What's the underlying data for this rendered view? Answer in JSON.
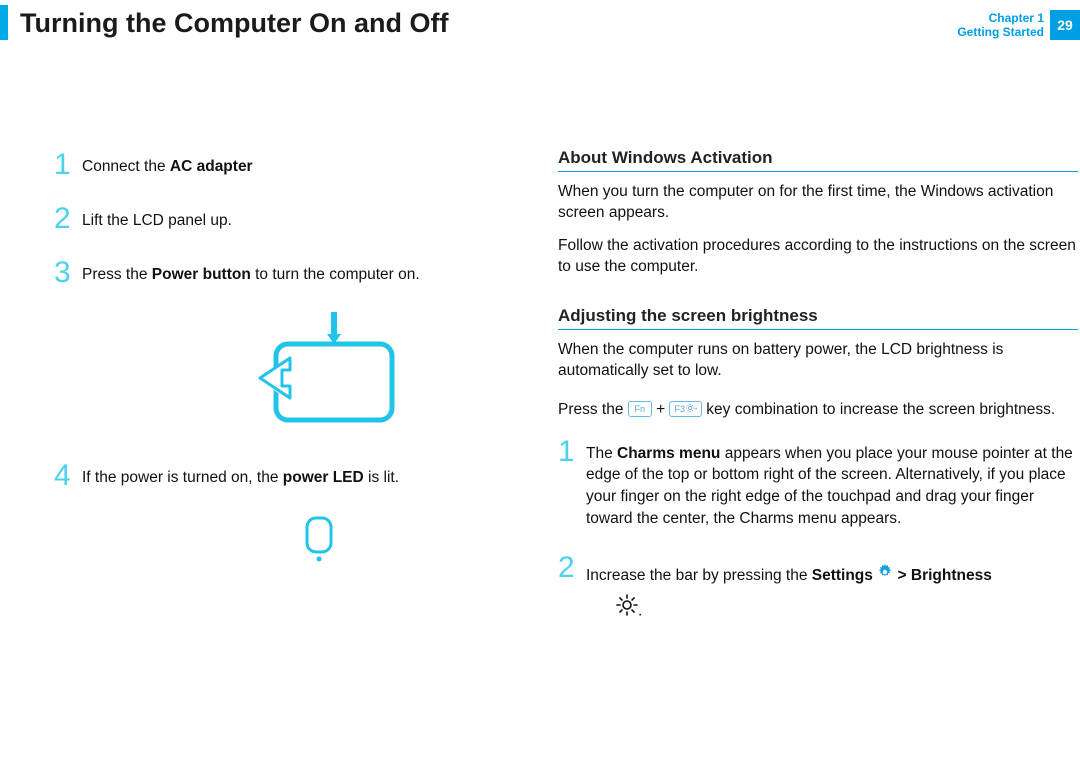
{
  "header": {
    "title": "Turning the Computer On and Off",
    "chapter_line1": "Chapter 1",
    "chapter_line2": "Getting Started",
    "page_number": "29"
  },
  "left_steps": {
    "s1": {
      "num": "1",
      "pre": "Connect the ",
      "bold": "AC adapter"
    },
    "s2": {
      "num": "2",
      "text": "Lift the LCD panel up."
    },
    "s3": {
      "num": "3",
      "pre": "Press the ",
      "bold": "Power button",
      "post": " to turn the computer on."
    },
    "s4": {
      "num": "4",
      "pre": "If the power is turned on, the ",
      "bold": "power LED",
      "post": " is lit."
    }
  },
  "right": {
    "section1_head": "About Windows Activation",
    "section1_p1": "When you turn the computer on for the ﬁrst time, the Windows activation screen appears.",
    "section1_p2": "Follow the activation procedures according to the instructions on the screen to use the computer.",
    "section2_head": "Adjusting the screen brightness",
    "section2_p1": "When the computer runs on battery power, the LCD brightness is automatically set to low.",
    "press_the": "Press the ",
    "fn_key": "Fn",
    "plus": " + ",
    "f3_label": "F3",
    "post_keys": " key combination to increase the screen brightness.",
    "rstep1": {
      "num": "1",
      "pre": "The ",
      "bold": "Charms menu",
      "post": " appears when you place your mouse pointer at the edge of the top or bottom right of the screen. Alternatively, if you place your ﬁnger on the right edge of the touchpad and drag your ﬁnger toward the center, the Charms menu appears."
    },
    "rstep2": {
      "num": "2",
      "pre": "Increase the bar by pressing the ",
      "bold1": "Settings ",
      "gt": " > ",
      "bold2": "Brightness",
      "dot": "."
    }
  }
}
